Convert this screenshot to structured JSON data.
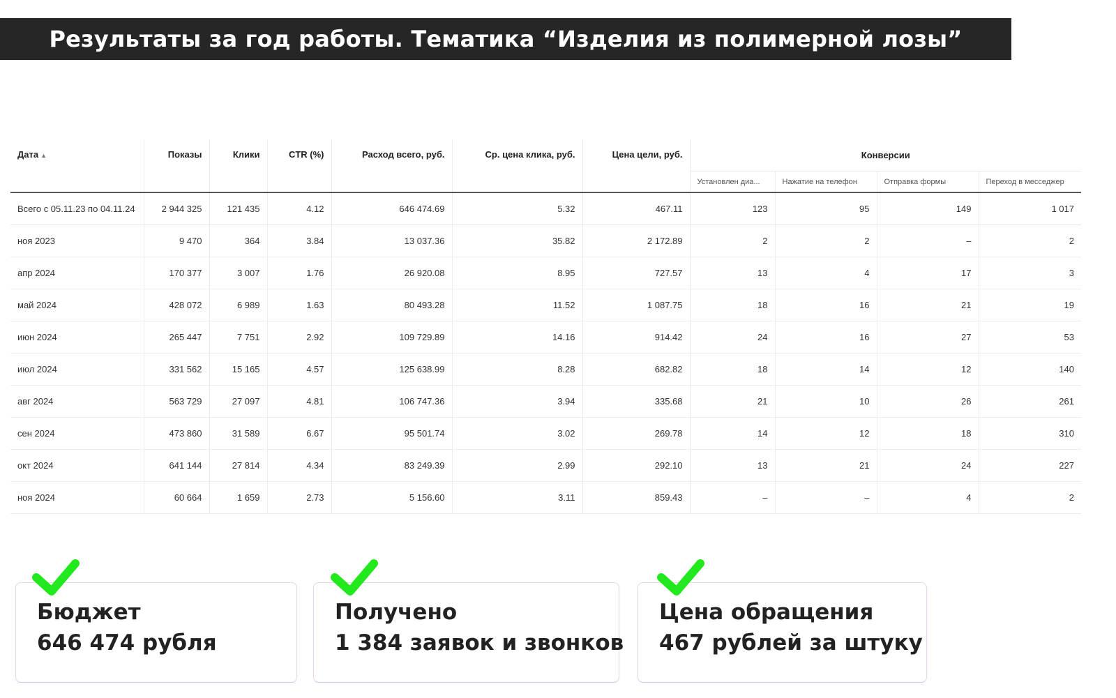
{
  "banner": {
    "title": "Результаты за год работы. Тематика “Изделия из полимерной лозы”"
  },
  "table": {
    "total_row": [
      "Всего с 05.11.23 по 04.11.24",
      "2 944 325",
      "121 435",
      "4.12",
      "646 474.69",
      "5.32",
      "467.11",
      "123",
      "95",
      "149",
      "1 017"
    ],
    "headers": {
      "date": "Дата",
      "shows": "Показы",
      "clicks": "Клики",
      "ctr": "CTR (%)",
      "cost": "Расход всего, руб.",
      "avg_click": "Ср. цена клика, руб.",
      "goal_price": "Цена цели, руб.",
      "conversions": "Конверсии",
      "sub": [
        "Установлен диа...",
        "Нажатие на телефон",
        "Отправка формы",
        "Переход в месседжер"
      ]
    },
    "rows": [
      [
        "ноя 2023",
        "9 470",
        "364",
        "3.84",
        "13 037.36",
        "35.82",
        "2 172.89",
        "2",
        "2",
        "–",
        "2"
      ],
      [
        "апр 2024",
        "170 377",
        "3 007",
        "1.76",
        "26 920.08",
        "8.95",
        "727.57",
        "13",
        "4",
        "17",
        "3"
      ],
      [
        "май 2024",
        "428 072",
        "6 989",
        "1.63",
        "80 493.28",
        "11.52",
        "1 087.75",
        "18",
        "16",
        "21",
        "19"
      ],
      [
        "июн 2024",
        "265 447",
        "7 751",
        "2.92",
        "109 729.89",
        "14.16",
        "914.42",
        "24",
        "16",
        "27",
        "53"
      ],
      [
        "июл 2024",
        "331 562",
        "15 165",
        "4.57",
        "125 638.99",
        "8.28",
        "682.82",
        "18",
        "14",
        "12",
        "140"
      ],
      [
        "авг 2024",
        "563 729",
        "27 097",
        "4.81",
        "106 747.36",
        "3.94",
        "335.68",
        "21",
        "10",
        "26",
        "261"
      ],
      [
        "сен 2024",
        "473 860",
        "31 589",
        "6.67",
        "95 501.74",
        "3.02",
        "269.78",
        "14",
        "12",
        "18",
        "310"
      ],
      [
        "окт 2024",
        "641 144",
        "27 814",
        "4.34",
        "83 249.39",
        "2.99",
        "292.10",
        "13",
        "21",
        "24",
        "227"
      ],
      [
        "ноя 2024",
        "60 664",
        "1 659",
        "2.73",
        "5 156.60",
        "3.11",
        "859.43",
        "–",
        "–",
        "4",
        "2"
      ]
    ]
  },
  "cards": [
    {
      "line1": "Бюджет",
      "line2": "646 474 рубля"
    },
    {
      "line1": "Получено",
      "line2": "1 384 заявок и звонков"
    },
    {
      "line1": "Цена обращения",
      "line2": "467 рублей за штуку"
    }
  ],
  "colors": {
    "banner_bg": "#262626",
    "check": "#22e81e"
  },
  "icons": {
    "check": "checkmark-icon",
    "sort": "sort-asc-icon"
  }
}
